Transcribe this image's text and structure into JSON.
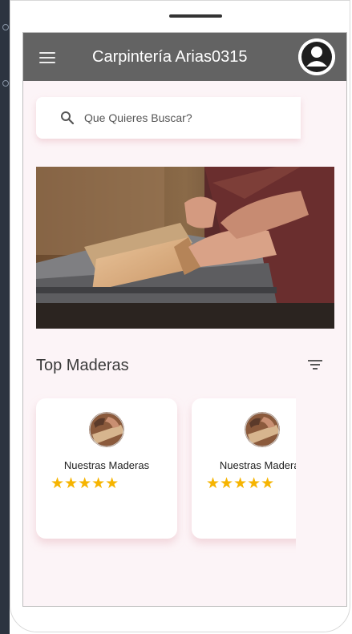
{
  "app": {
    "title": "Carpintería Arias0315"
  },
  "search": {
    "placeholder": "Que Quieres Buscar?",
    "value": ""
  },
  "section": {
    "title": "Top Maderas"
  },
  "products": [
    {
      "title": "Nuestras Maderas",
      "rating": 5,
      "stars": "★★★★★"
    },
    {
      "title": "Nuestras Maderas",
      "rating": 5,
      "stars": "★★★★★"
    }
  ],
  "colors": {
    "appbar": "#636363",
    "screen_bg": "#fcf4f7",
    "star": "#f6b400"
  },
  "icons": [
    "menu-icon",
    "user-avatar-icon",
    "search-icon",
    "filter-icon",
    "star-icon"
  ]
}
